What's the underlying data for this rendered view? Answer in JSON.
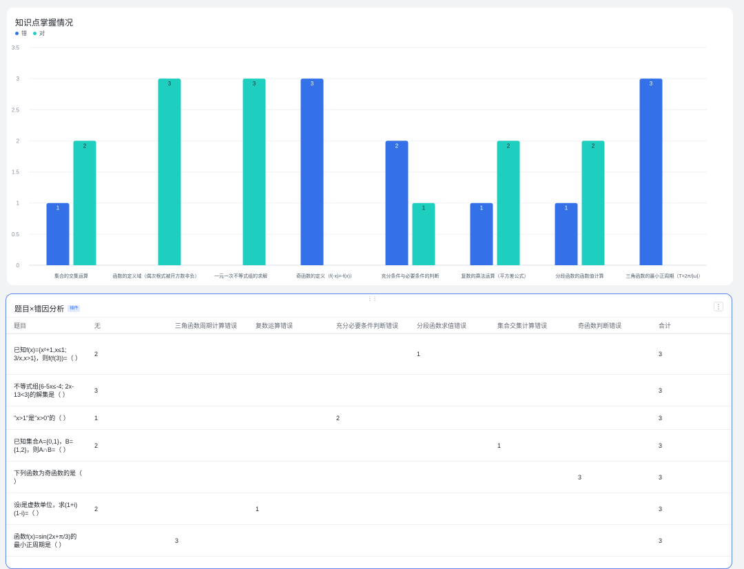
{
  "chart_card": {
    "title": "知识点掌握情况"
  },
  "chart_data": {
    "type": "bar",
    "categories": [
      "集合的交集运算",
      "函数的定义域（偶次根式被开方数非负）",
      "一元一次不等式组的求解",
      "奇函数的定义（f(-x)=-f(x)）",
      "充分条件与必要条件的判断",
      "复数的乘法运算（平方差公式）",
      "分段函数的函数值计算",
      "三角函数的最小正周期（T=2π/|ω|）"
    ],
    "series": [
      {
        "name": "错",
        "color": "#3471e8",
        "values": [
          1,
          null,
          null,
          3,
          2,
          1,
          1,
          3
        ]
      },
      {
        "name": "对",
        "color": "#1ecfc0",
        "values": [
          2,
          3,
          3,
          null,
          1,
          2,
          2,
          null
        ]
      }
    ],
    "yticks": [
      "0",
      "0.5",
      "1",
      "1.5",
      "2",
      "2.5",
      "3",
      "3.5"
    ],
    "ylim": [
      0,
      3.5
    ],
    "grid": true,
    "legend_position": "top-left"
  },
  "panel": {
    "title": "题目×错因分析",
    "badge": "插件",
    "drag_icon": "drag-handle-icon",
    "more_icon": "more-vertical-icon",
    "more_glyph": "⋮",
    "drag_glyph": "⋮⋮"
  },
  "table": {
    "columns": [
      "题目",
      "无",
      "三角函数周期计算错误",
      "复数运算错误",
      "充分必要条件判断错误",
      "分段函数求值错误",
      "集合交集计算错误",
      "奇函数判断错误",
      "合计"
    ],
    "rows": [
      {
        "cells": [
          "已知f(x)={x²+1,x≤1; 3/x,x>1}，则f(f(3))=（ ）",
          "2",
          "",
          "",
          "",
          "1",
          "",
          "",
          "3"
        ]
      },
      {
        "cells": [
          "不等式组{6-5x≤-4; 2x-13<3}的解集是（ ）",
          "3",
          "",
          "",
          "",
          "",
          "",
          "",
          "3"
        ]
      },
      {
        "cells": [
          "\"x>1\"是\"x>0\"的（ ）",
          "1",
          "",
          "",
          "2",
          "",
          "",
          "",
          "3"
        ]
      },
      {
        "cells": [
          "已知集合A={0,1}，B={1,2}，则A∩B=（ ）",
          "2",
          "",
          "",
          "",
          "",
          "1",
          "",
          "3"
        ]
      },
      {
        "cells": [
          "下列函数为奇函数的是（ ）",
          "",
          "",
          "",
          "",
          "",
          "",
          "3",
          "3"
        ]
      },
      {
        "cells": [
          "设i是虚数单位，求(1+i)(1-i)=（ ）",
          "2",
          "",
          "1",
          "",
          "",
          "",
          "",
          "3"
        ]
      },
      {
        "cells": [
          "函数f(x)=sin(2x+π/3)的最小正周期是（ ）",
          "",
          "3",
          "",
          "",
          "",
          "",
          "",
          "3"
        ]
      }
    ]
  }
}
